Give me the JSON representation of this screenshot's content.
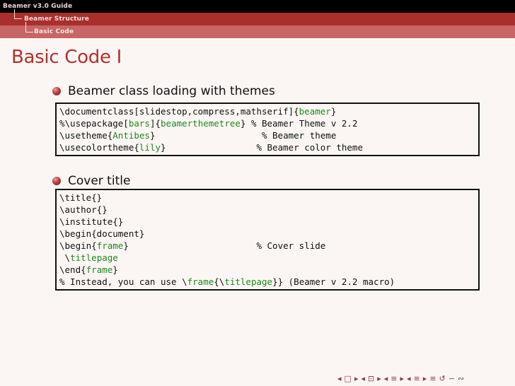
{
  "header": {
    "guide": "Beamer v3.0 Guide",
    "section": "Beamer Structure",
    "subsection": "Basic Code"
  },
  "slide": {
    "title": "Basic Code I",
    "items": [
      {
        "label": "Beamer class loading with themes",
        "code": [
          [
            {
              "t": "\\documentclass[slidestop,compress,mathserif]{"
            },
            {
              "t": "beamer",
              "k": 1
            },
            {
              "t": "}"
            }
          ],
          [
            {
              "t": "%\\usepackage["
            },
            {
              "t": "bars",
              "k": 1
            },
            {
              "t": "]{"
            },
            {
              "t": "beamerthemetree",
              "k": 1
            },
            {
              "t": "} % Beamer Theme v 2.2"
            }
          ],
          [
            {
              "t": "\\usetheme{"
            },
            {
              "t": "Antibes",
              "k": 1
            },
            {
              "t": "}                    % Beamer theme"
            }
          ],
          [
            {
              "t": "\\usecolortheme{"
            },
            {
              "t": "lily",
              "k": 1
            },
            {
              "t": "}                 % Beamer color theme"
            }
          ]
        ]
      },
      {
        "label": "Cover title",
        "code": [
          [
            {
              "t": "\\title{}"
            }
          ],
          [
            {
              "t": "\\author{}"
            }
          ],
          [
            {
              "t": "\\institute{}"
            }
          ],
          [
            {
              "t": "\\begin{document}"
            }
          ],
          [
            {
              "t": "\\begin{"
            },
            {
              "t": "frame",
              "k": 1
            },
            {
              "t": "}                        % Cover slide"
            }
          ],
          [
            {
              "t": " \\"
            },
            {
              "t": "titlepage",
              "k": 1
            }
          ],
          [
            {
              "t": "\\end{"
            },
            {
              "t": "frame",
              "k": 1
            },
            {
              "t": "}"
            }
          ],
          [
            {
              "t": "% Instead, you can use \\"
            },
            {
              "t": "frame",
              "k": 1
            },
            {
              "t": "{\\"
            },
            {
              "t": "titlepage",
              "k": 1
            },
            {
              "t": "}} (Beamer v 2.2 macro)"
            }
          ]
        ]
      }
    ]
  },
  "nav_icons": [
    "◂",
    "□",
    "▸",
    "◂",
    "⊡",
    "▸",
    "◂",
    "≡",
    "▸",
    "◂",
    "≡",
    "▸",
    "≡",
    "↺",
    "∽",
    "∾"
  ],
  "colors": {
    "accent": "#b4312c",
    "keyword": "#1c8a1c",
    "background": "#fbf6f4"
  }
}
